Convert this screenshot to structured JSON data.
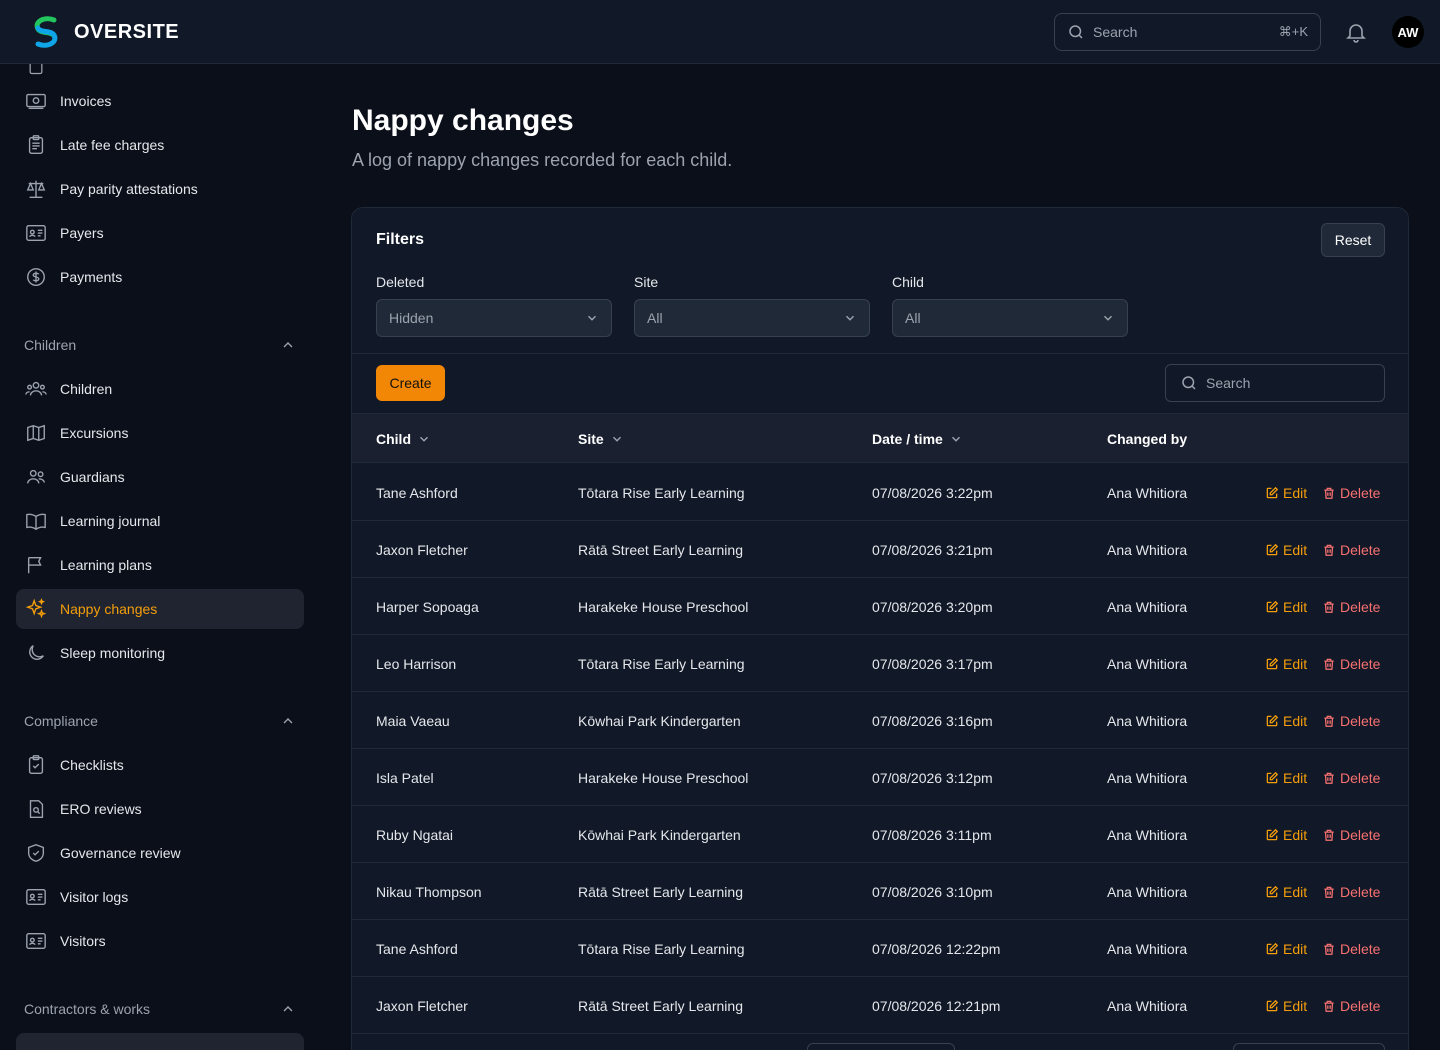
{
  "app": {
    "name": "OVERSITE"
  },
  "topbar": {
    "search_placeholder": "Search",
    "search_shortcut": "⌘+K",
    "avatar_initials": "AW"
  },
  "sidebar": {
    "items_top": [
      {
        "label": "Invoices",
        "icon": "invoice-icon"
      },
      {
        "label": "Late fee charges",
        "icon": "clipboard-icon"
      },
      {
        "label": "Pay parity attestations",
        "icon": "scale-icon"
      },
      {
        "label": "Payers",
        "icon": "id-card-icon"
      },
      {
        "label": "Payments",
        "icon": "dollar-circle-icon"
      }
    ],
    "sections": [
      {
        "title": "Children",
        "items": [
          {
            "label": "Children",
            "icon": "users-icon"
          },
          {
            "label": "Excursions",
            "icon": "map-icon"
          },
          {
            "label": "Guardians",
            "icon": "user-group-icon"
          },
          {
            "label": "Learning journal",
            "icon": "book-open-icon"
          },
          {
            "label": "Learning plans",
            "icon": "flag-icon"
          },
          {
            "label": "Nappy changes",
            "icon": "sparkles-icon",
            "active": true
          },
          {
            "label": "Sleep monitoring",
            "icon": "moon-icon"
          }
        ]
      },
      {
        "title": "Compliance",
        "items": [
          {
            "label": "Checklists",
            "icon": "clipboard-check-icon"
          },
          {
            "label": "ERO reviews",
            "icon": "document-search-icon"
          },
          {
            "label": "Governance review",
            "icon": "shield-check-icon"
          },
          {
            "label": "Visitor logs",
            "icon": "id-card-icon"
          },
          {
            "label": "Visitors",
            "icon": "id-card-icon"
          }
        ]
      },
      {
        "title": "Contractors & works",
        "items": []
      }
    ]
  },
  "page": {
    "title": "Nappy changes",
    "subtitle": "A log of nappy changes recorded for each child."
  },
  "filters": {
    "title": "Filters",
    "reset_label": "Reset",
    "fields": [
      {
        "label": "Deleted",
        "value": "Hidden"
      },
      {
        "label": "Site",
        "value": "All"
      },
      {
        "label": "Child",
        "value": "All"
      }
    ]
  },
  "toolbar": {
    "create_label": "Create",
    "search_placeholder": "Search"
  },
  "table": {
    "columns": [
      "Child",
      "Site",
      "Date / time",
      "Changed by"
    ],
    "edit_label": "Edit",
    "delete_label": "Delete",
    "rows": [
      {
        "child": "Tane Ashford",
        "site": "Tōtara Rise Early Learning",
        "datetime": "07/08/2026 3:22pm",
        "changed_by": "Ana Whitiora"
      },
      {
        "child": "Jaxon Fletcher",
        "site": "Rātā Street Early Learning",
        "datetime": "07/08/2026 3:21pm",
        "changed_by": "Ana Whitiora"
      },
      {
        "child": "Harper Sopoaga",
        "site": "Harakeke House Preschool",
        "datetime": "07/08/2026 3:20pm",
        "changed_by": "Ana Whitiora"
      },
      {
        "child": "Leo Harrison",
        "site": "Tōtara Rise Early Learning",
        "datetime": "07/08/2026 3:17pm",
        "changed_by": "Ana Whitiora"
      },
      {
        "child": "Maia Vaeau",
        "site": "Kōwhai Park Kindergarten",
        "datetime": "07/08/2026 3:16pm",
        "changed_by": "Ana Whitiora"
      },
      {
        "child": "Isla Patel",
        "site": "Harakeke House Preschool",
        "datetime": "07/08/2026 3:12pm",
        "changed_by": "Ana Whitiora"
      },
      {
        "child": "Ruby Ngatai",
        "site": "Kōwhai Park Kindergarten",
        "datetime": "07/08/2026 3:11pm",
        "changed_by": "Ana Whitiora"
      },
      {
        "child": "Nikau Thompson",
        "site": "Rātā Street Early Learning",
        "datetime": "07/08/2026 3:10pm",
        "changed_by": "Ana Whitiora"
      },
      {
        "child": "Tane Ashford",
        "site": "Tōtara Rise Early Learning",
        "datetime": "07/08/2026 12:22pm",
        "changed_by": "Ana Whitiora"
      },
      {
        "child": "Jaxon Fletcher",
        "site": "Rātā Street Early Learning",
        "datetime": "07/08/2026 12:21pm",
        "changed_by": "Ana Whitiora"
      }
    ]
  },
  "colors": {
    "accent": "#f59e0b",
    "create_button": "#f28705",
    "delete": "#f87171"
  }
}
